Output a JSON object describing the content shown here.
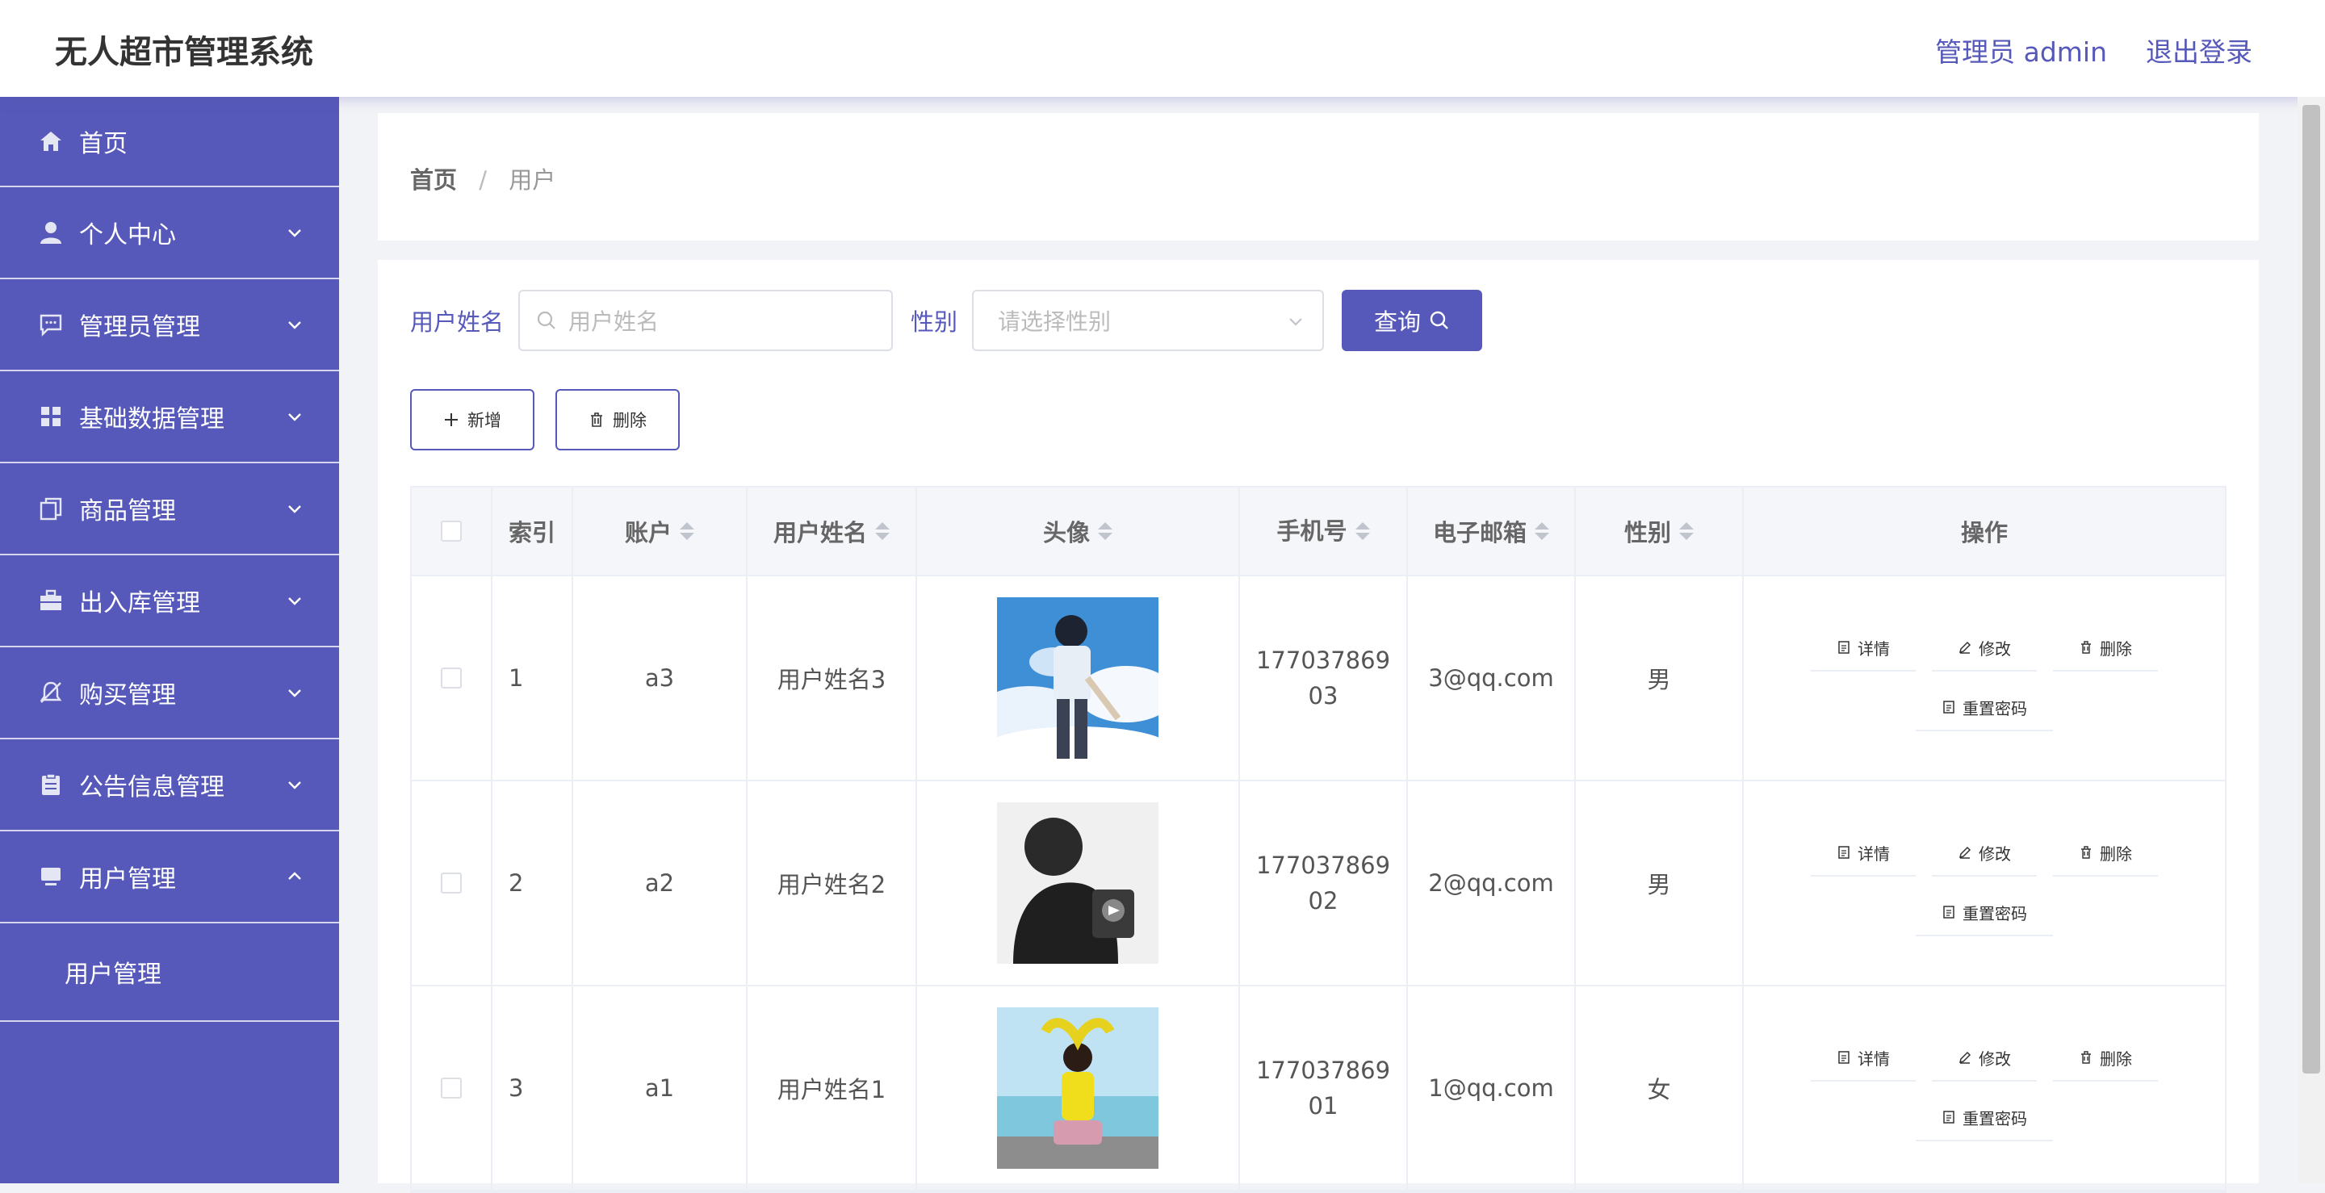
{
  "header": {
    "app_title": "无人超市管理系统",
    "admin_label": "管理员 admin",
    "logout_label": "退出登录"
  },
  "sidebar": {
    "items": [
      {
        "label": "首页",
        "icon": "home-icon"
      },
      {
        "label": "个人中心",
        "icon": "user-icon"
      },
      {
        "label": "管理员管理",
        "icon": "chat-icon"
      },
      {
        "label": "基础数据管理",
        "icon": "grid-icon"
      },
      {
        "label": "商品管理",
        "icon": "copy-icon"
      },
      {
        "label": "出入库管理",
        "icon": "briefcase-icon"
      },
      {
        "label": "购买管理",
        "icon": "bell-off-icon"
      },
      {
        "label": "公告信息管理",
        "icon": "clipboard-icon"
      },
      {
        "label": "用户管理",
        "icon": "monitor-icon"
      }
    ],
    "submenu_label": "用户管理"
  },
  "breadcrumb": {
    "home": "首页",
    "separator": "/",
    "current": "用户"
  },
  "search": {
    "name_label": "用户姓名",
    "name_placeholder": "用户姓名",
    "sex_label": "性别",
    "sex_placeholder": "请选择性别",
    "query_label": "查询"
  },
  "actions": {
    "add_label": "新增",
    "delete_label": "删除"
  },
  "table": {
    "headers": {
      "index": "索引",
      "account": "账户",
      "name": "用户姓名",
      "avatar": "头像",
      "phone": "手机号",
      "email": "电子邮箱",
      "sex": "性别",
      "ops": "操作"
    },
    "op_labels": {
      "detail": "详情",
      "edit": "修改",
      "delete": "删除",
      "reset": "重置密码"
    },
    "rows": [
      {
        "index": "1",
        "account": "a3",
        "name": "用户姓名3",
        "phone": "17703786903",
        "email": "3@qq.com",
        "sex": "男"
      },
      {
        "index": "2",
        "account": "a2",
        "name": "用户姓名2",
        "phone": "17703786902",
        "email": "2@qq.com",
        "sex": "男"
      },
      {
        "index": "3",
        "account": "a1",
        "name": "用户姓名1",
        "phone": "17703786901",
        "email": "1@qq.com",
        "sex": "女"
      }
    ]
  },
  "colors": {
    "accent": "#5659b9",
    "border": "#ebeef5",
    "header_bg": "#f5f6fa"
  }
}
